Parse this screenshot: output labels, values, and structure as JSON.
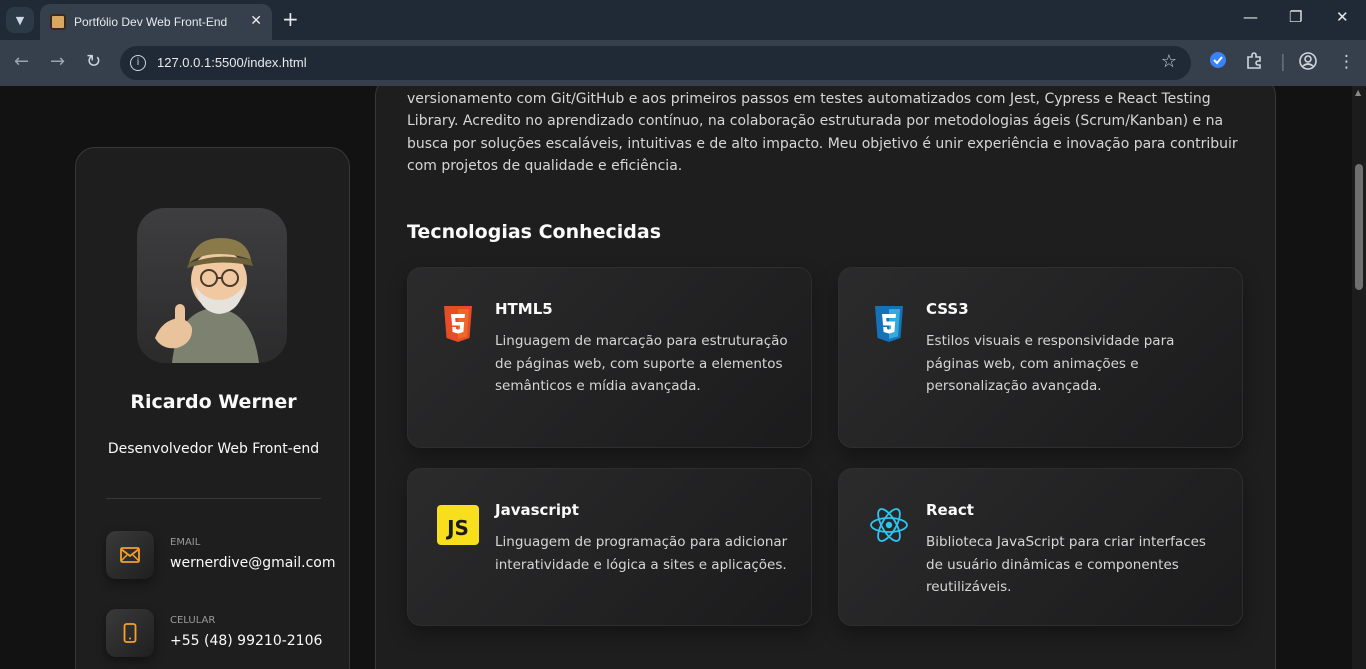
{
  "browser": {
    "tab_title": "Portfólio Dev Web Front-End",
    "url": "127.0.0.1:5500/index.html"
  },
  "sidebar": {
    "name": "Ricardo Werner",
    "role": "Desenvolvedor Web Front-end",
    "contacts": [
      {
        "label": "EMAIL",
        "value": "wernerdive@gmail.com",
        "icon": "mail-icon"
      },
      {
        "label": "CELULAR",
        "value": "+55 (48) 99210-2106",
        "icon": "phone-icon"
      }
    ]
  },
  "main": {
    "about_text": "Trago um olhar analítico desenvolvido ao longo da minha trajetória, aliado a práticas modernas de desenvolvimento, versionamento com Git/GitHub e aos primeiros passos em testes automatizados com Jest, Cypress e React Testing Library. Acredito no aprendizado contínuo, na colaboração estruturada por metodologias ágeis (Scrum/Kanban) e na busca por soluções escaláveis, intuitivas e de alto impacto. Meu objetivo é unir experiência e inovação para contribuir com projetos de qualidade e eficiência.",
    "tech_title": "Tecnologias Conhecidas",
    "techs": [
      {
        "title": "HTML5",
        "text": "Linguagem de marcação para estruturação de páginas web, com suporte a elementos semânticos e mídia avançada.",
        "icon": "html5-icon"
      },
      {
        "title": "CSS3",
        "text": "Estilos visuais e responsividade para páginas web, com animações e personalização avançada.",
        "icon": "css3-icon"
      },
      {
        "title": "Javascript",
        "text": "Linguagem de programação para adicionar interatividade e lógica a sites e aplicações.",
        "icon": "javascript-icon"
      },
      {
        "title": "React",
        "text": "Biblioteca JavaScript para criar interfaces de usuário dinâmicas e componentes reutilizáveis.",
        "icon": "react-icon"
      }
    ]
  },
  "colors": {
    "accent": "#f4a02c",
    "html5": "#e44d26",
    "css3": "#1572b6",
    "js": "#f7df1e",
    "react": "#61dafb"
  }
}
